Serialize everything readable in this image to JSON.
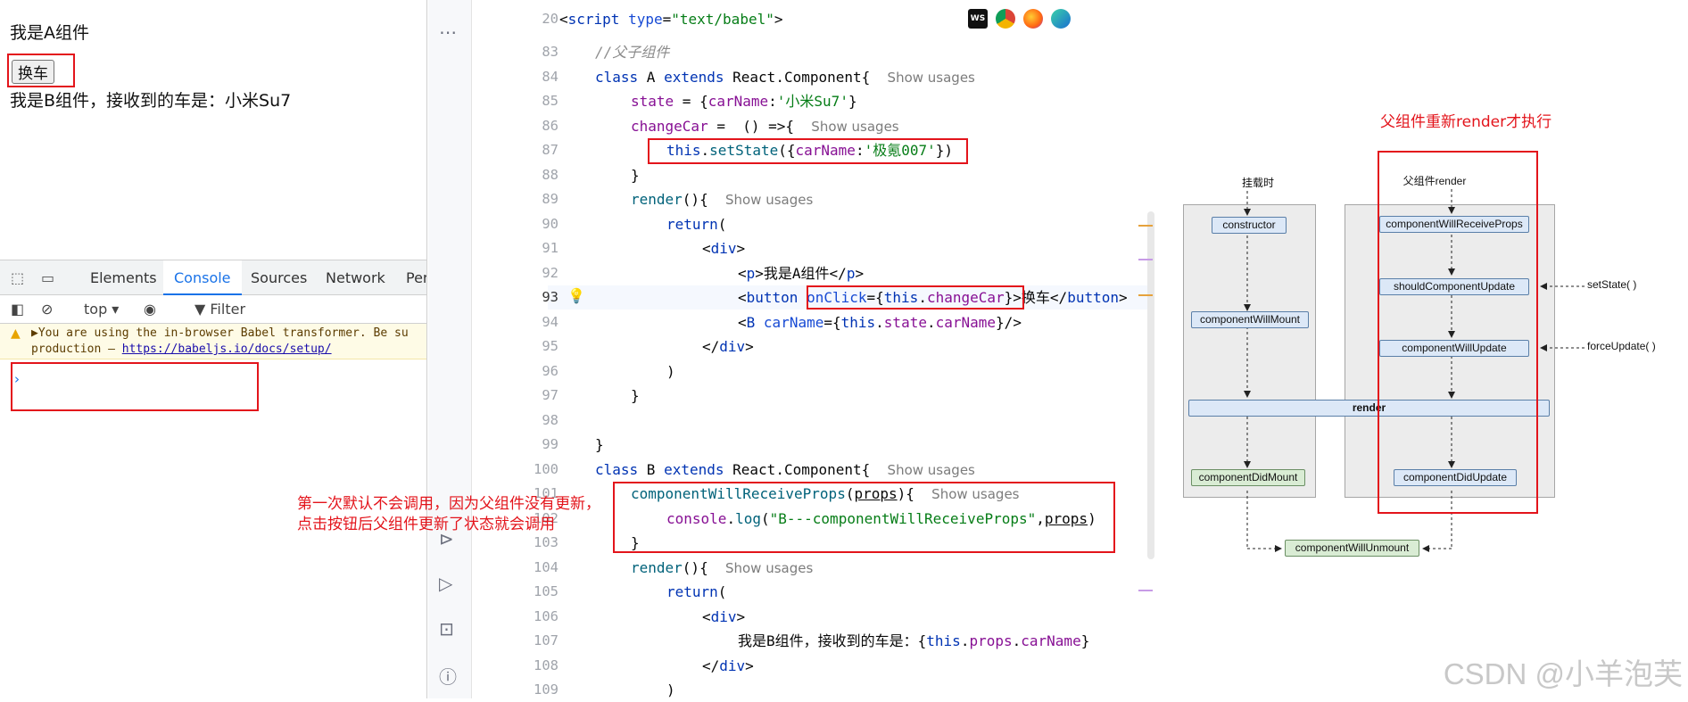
{
  "browser_page": {
    "line_a": "我是A组件",
    "button_label": "换车",
    "line_b": "我是B组件，接收到的车是：小米Su7"
  },
  "devtools": {
    "tabs": [
      "Elements",
      "Console",
      "Sources",
      "Network",
      "Per"
    ],
    "active_tab": "Console",
    "context": "top",
    "filter_placeholder": "Filter",
    "warning_line1": "▶You are using the in-browser Babel transformer. Be su",
    "warning_line2_prefix": "production – ",
    "warning_link": "https://babeljs.io/docs/setup/",
    "prompt": "›"
  },
  "editor": {
    "hint": "Show usages",
    "lines": [
      {
        "n": "20"
      },
      {
        "n": "83"
      },
      {
        "n": "84"
      },
      {
        "n": "85"
      },
      {
        "n": "86"
      },
      {
        "n": "87"
      },
      {
        "n": "88"
      },
      {
        "n": "89"
      },
      {
        "n": "90"
      },
      {
        "n": "91"
      },
      {
        "n": "92"
      },
      {
        "n": "93"
      },
      {
        "n": "94"
      },
      {
        "n": "95"
      },
      {
        "n": "96"
      },
      {
        "n": "97"
      },
      {
        "n": "98"
      },
      {
        "n": "99"
      },
      {
        "n": "100"
      },
      {
        "n": "101"
      },
      {
        "n": "102"
      },
      {
        "n": "103"
      },
      {
        "n": "104"
      },
      {
        "n": "105"
      },
      {
        "n": "106"
      },
      {
        "n": "107"
      },
      {
        "n": "108"
      },
      {
        "n": "109"
      }
    ],
    "browser_icons": [
      "WS",
      "Chrome",
      "Firefox",
      "Edge"
    ]
  },
  "annotations": {
    "left_note_1": "第一次默认不会调用，因为父组件没有更新，",
    "left_note_2": "点击按钮后父组件更新了状态就会调用",
    "right_note": "父组件重新render才执行"
  },
  "diagram": {
    "mount_title": "挂载时",
    "update_title": "父组件render",
    "constructor": "constructor",
    "will_mount": "componentWillMount",
    "did_mount": "componentDidMount",
    "will_receive_props": "componentWillReceiveProps",
    "should_update": "shouldComponentUpdate",
    "will_update": "componentWillUpdate",
    "did_update": "componentDidUpdate",
    "render": "render",
    "will_unmount": "componentWillUnmount",
    "set_state": "setState( )",
    "force_update": "forceUpdate( )"
  },
  "watermark": "CSDN @小羊泡芙"
}
